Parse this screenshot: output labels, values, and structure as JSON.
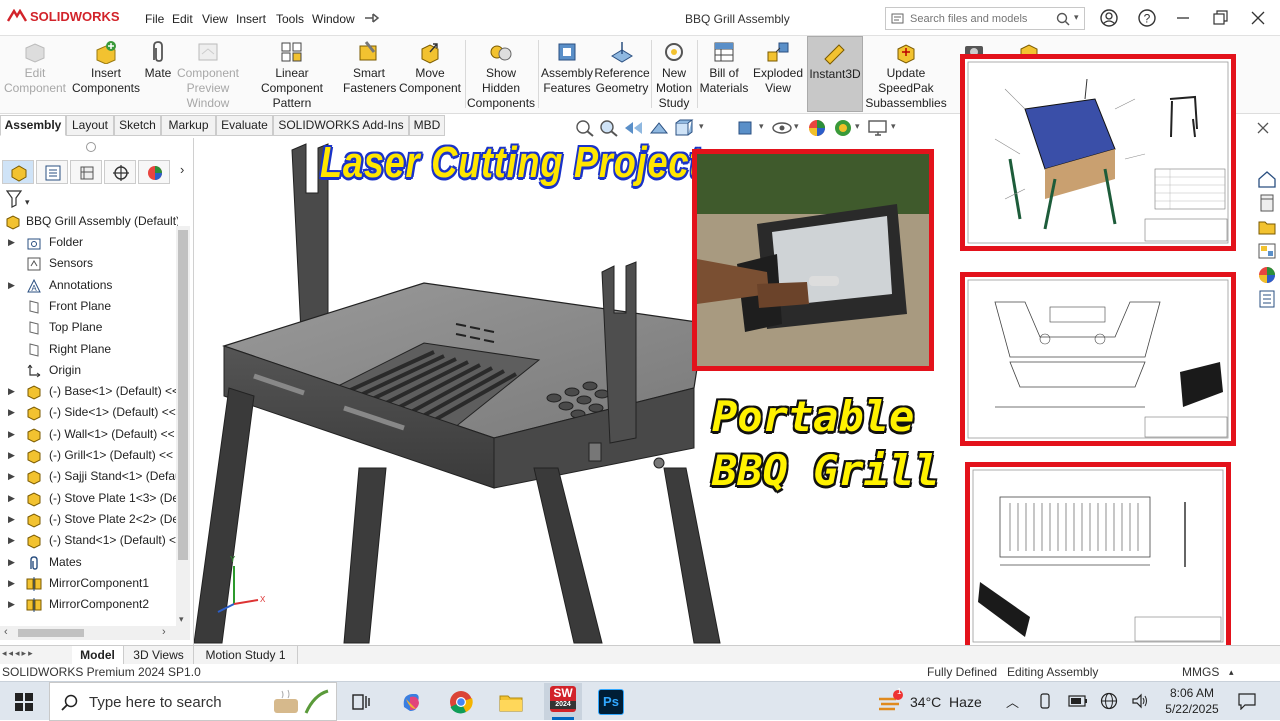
{
  "app": {
    "logo": "SOLIDWORKS",
    "title": "BBQ Grill Assembly",
    "menu": [
      "File",
      "Edit",
      "View",
      "Insert",
      "Tools",
      "Window"
    ],
    "search_placeholder": "Search files and models"
  },
  "ribbon": {
    "buttons": [
      {
        "label": "Edit Component",
        "disabled": true
      },
      {
        "label": "Insert Components",
        "disabled": false
      },
      {
        "label": "Mate",
        "disabled": false
      },
      {
        "label": "Component Preview Window",
        "disabled": true
      },
      {
        "label": "Linear Component Pattern",
        "disabled": false
      },
      {
        "label": "Smart Fasteners",
        "disabled": false
      },
      {
        "label": "Move Component",
        "disabled": false
      },
      {
        "label": "Show Hidden Components",
        "disabled": false
      },
      {
        "label": "Assembly Features",
        "disabled": false
      },
      {
        "label": "Reference Geometry",
        "disabled": false
      },
      {
        "label": "New Motion Study",
        "disabled": false
      },
      {
        "label": "Bill of Materials",
        "disabled": false
      },
      {
        "label": "Exploded View",
        "disabled": false
      },
      {
        "label": "Instant3D",
        "disabled": false
      },
      {
        "label": "Update SpeedPak Subassemblies",
        "disabled": false
      }
    ]
  },
  "cmd_tabs": [
    "Assembly",
    "Layout",
    "Sketch",
    "Markup",
    "Evaluate",
    "SOLIDWORKS Add-Ins",
    "MBD"
  ],
  "tree": {
    "root": "BBQ Grill Assembly (Default)",
    "items": [
      "Folder",
      "Sensors",
      "Annotations",
      "Front Plane",
      "Top Plane",
      "Right Plane",
      "Origin",
      "(-) Base<1> (Default) <<",
      "(-) Side<1> (Default) <<",
      "(-) Wall<1> (Default) <<",
      "(-) Grill<1> (Default) <<",
      "(-) Sajji Stand<1> (Defau",
      "(-) Stove Plate 1<3> (De",
      "(-) Stove Plate 2<2> (De",
      "(-) Stand<1> (Default) <",
      "Mates",
      "MirrorComponent1",
      "MirrorComponent2"
    ]
  },
  "overlay": {
    "headline_top": "Laser Cutting Project",
    "headline_line1": "Portable",
    "headline_line2": "BBQ Grill"
  },
  "bottom_tabs": [
    "Model",
    "3D Views",
    "Motion Study 1"
  ],
  "status": {
    "product": "SOLIDWORKS Premium 2024 SP1.0",
    "state": "Fully Defined",
    "mode": "Editing Assembly",
    "units": "MMGS"
  },
  "taskbar": {
    "search_placeholder": "Type here to search",
    "weather": "34°C  Haze",
    "time": "8:06 AM",
    "date": "5/22/2025",
    "sw_badge": "2024",
    "notif_count": "1"
  },
  "triad": {
    "x": "X",
    "y": "Y"
  },
  "colors": {
    "accent": "#d2232a",
    "highlight_border": "#e3121b",
    "headline_yellow": "#ffe600",
    "headline_outline": "#1a33c8"
  }
}
